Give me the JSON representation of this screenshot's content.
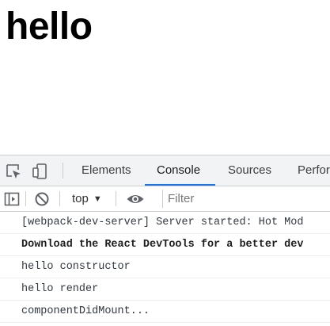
{
  "page": {
    "heading": "hello"
  },
  "devtools": {
    "toolbar_icons": [
      "inspect-element-icon",
      "device-toolbar-icon"
    ],
    "tabs": [
      {
        "label": "Elements",
        "active": false
      },
      {
        "label": "Console",
        "active": true
      },
      {
        "label": "Sources",
        "active": false
      },
      {
        "label": "Perfor",
        "active": false
      }
    ],
    "console": {
      "toolbar_icons": [
        "sidebar-toggle-icon",
        "clear-console-icon",
        "eye-icon"
      ],
      "context": "top",
      "filter_placeholder": "Filter",
      "messages": [
        {
          "text": "[webpack-dev-server] Server started: Hot Mod",
          "bold": false
        },
        {
          "text": "Download the React DevTools for a better dev",
          "bold": true
        },
        {
          "text": "hello constructor",
          "bold": false
        },
        {
          "text": "hello render",
          "bold": false
        },
        {
          "text": "componentDidMount...",
          "bold": false
        }
      ]
    },
    "colors": {
      "accent": "#1a73e8",
      "toolbar_bg": "#f1f3f4",
      "icon": "#5f6368"
    }
  }
}
